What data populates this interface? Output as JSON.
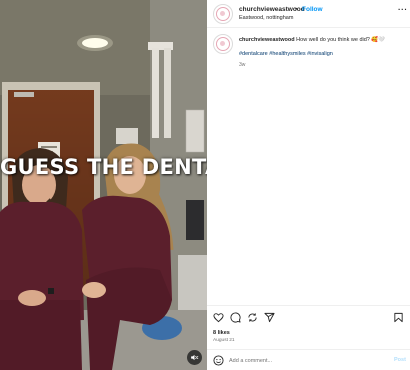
{
  "media": {
    "overlay_text": "GUESS THE DENTAL",
    "mute_icon": "speaker-muted-icon"
  },
  "post": {
    "username": "churchvieweastwood",
    "dot": "•",
    "follow_label": "Follow",
    "location": "Eastwood, nottingham",
    "more_label": "···"
  },
  "caption": {
    "username": "churchvieweastwood",
    "text": "How well do you think we did? 🥰🤍",
    "hashtags": "#dentalcare #healthysmiles #invisalign",
    "time": "3w"
  },
  "actions": {
    "icons": [
      "heart-icon",
      "comment-icon",
      "share-icon",
      "send-icon",
      "bookmark-icon"
    ],
    "likes": "8 likes",
    "date": "August 21"
  },
  "comment": {
    "placeholder": "Add a comment...",
    "post_label": "Post"
  },
  "colors": {
    "follow_blue": "#0095f6",
    "hashtag_blue": "#00376b",
    "post_disabled": "#b2dffc",
    "scrub_maroon": "#5b1f2c"
  }
}
